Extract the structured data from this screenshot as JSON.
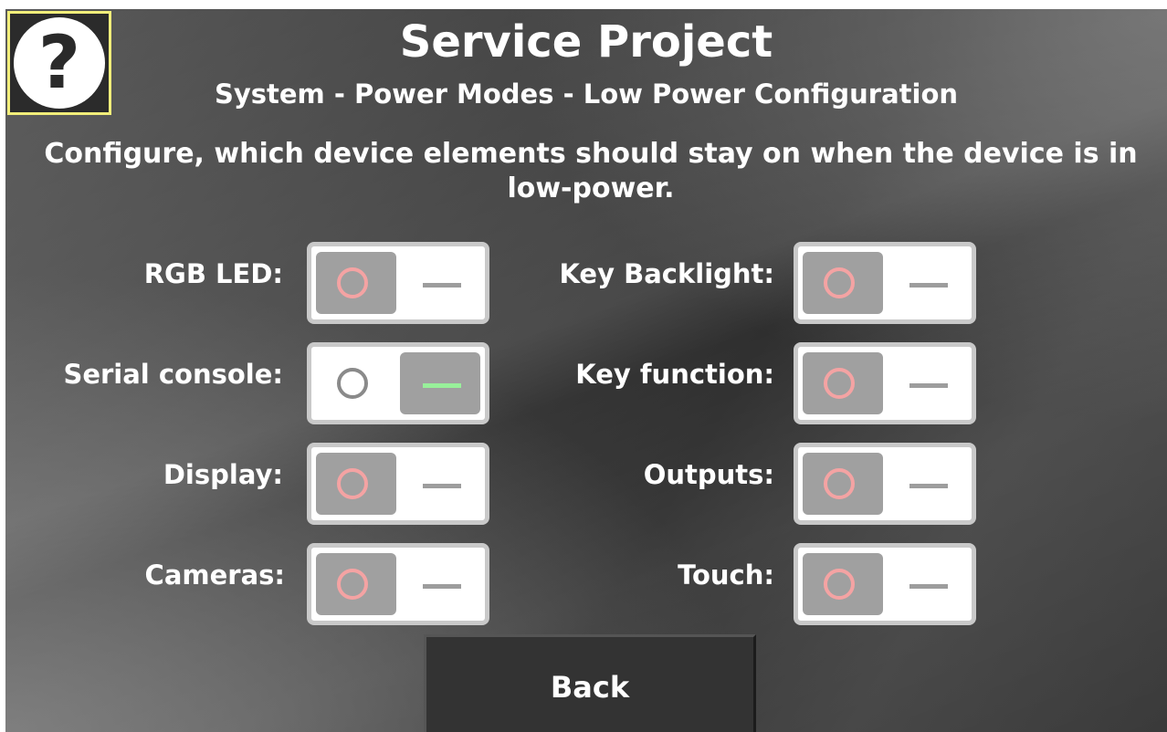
{
  "header": {
    "title": "Service Project",
    "subtitle": "System - Power Modes - Low Power Configuration",
    "help_icon": "question-mark-icon",
    "help_glyph": "?"
  },
  "description": "Configure, which device elements should stay on when the device is in low-power.",
  "settings": [
    {
      "label": "RGB LED:",
      "state": "off"
    },
    {
      "label": "Serial console:",
      "state": "on"
    },
    {
      "label": "Display:",
      "state": "off"
    },
    {
      "label": "Cameras:",
      "state": "off"
    },
    {
      "label": "Key Backlight:",
      "state": "off"
    },
    {
      "label": "Key function:",
      "state": "off"
    },
    {
      "label": "Outputs:",
      "state": "off"
    },
    {
      "label": "Touch:",
      "state": "off"
    }
  ],
  "back_label": "Back",
  "colors": {
    "help_border": "#f2ee7a",
    "toggle_off_indicator": "#f4a3a3",
    "toggle_on_indicator": "#98f09a",
    "knob": "#a0a0a0"
  }
}
